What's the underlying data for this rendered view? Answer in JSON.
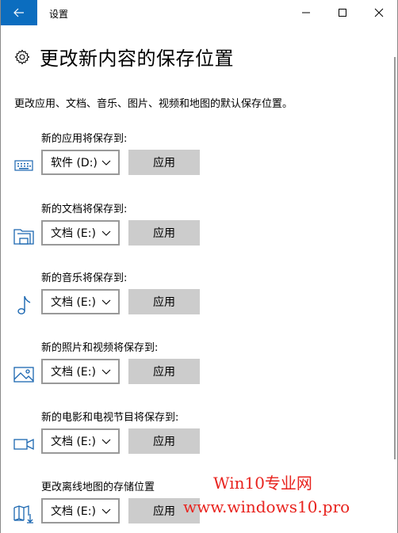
{
  "window": {
    "title": "设置",
    "accent": "#0b6dbf"
  },
  "page": {
    "title": "更改新内容的保存位置",
    "description": "更改应用、文档、音乐、图片、视频和地图的默认保存位置。"
  },
  "settings": [
    {
      "label": "新的应用将保存到:",
      "icon": "keyboard-icon",
      "drive": "软件 (D:)",
      "apply": "应用"
    },
    {
      "label": "新的文档将保存到:",
      "icon": "folder-document-icon",
      "drive": "文档 (E:)",
      "apply": "应用"
    },
    {
      "label": "新的音乐将保存到:",
      "icon": "music-note-icon",
      "drive": "文档 (E:)",
      "apply": "应用"
    },
    {
      "label": "新的照片和视频将保存到:",
      "icon": "picture-icon",
      "drive": "文档 (E:)",
      "apply": "应用"
    },
    {
      "label": "新的电影和电视节目将保存到:",
      "icon": "video-camera-icon",
      "drive": "文档 (E:)",
      "apply": "应用"
    },
    {
      "label": "更改离线地图的存储位置",
      "icon": "map-download-icon",
      "drive": "文档 (E:)",
      "apply": "应用"
    }
  ],
  "watermark": {
    "line1": "Win10专业网",
    "line2": "www.windows10.pro",
    "color": "#e8231e"
  }
}
